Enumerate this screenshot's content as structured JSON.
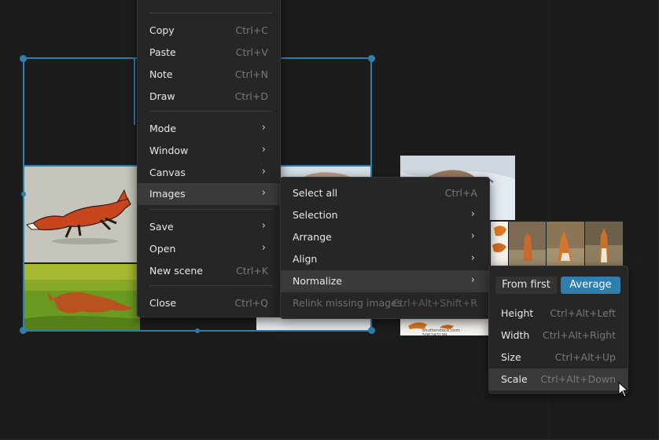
{
  "colors": {
    "accent": "#2e7fb0",
    "menu_bg": "#262626",
    "canvas_bg": "#1c1c1c"
  },
  "main_menu": {
    "items": [
      {
        "label": "Copy",
        "shortcut": "Ctrl+C"
      },
      {
        "label": "Paste",
        "shortcut": "Ctrl+V"
      },
      {
        "label": "Note",
        "shortcut": "Ctrl+N"
      },
      {
        "label": "Draw",
        "shortcut": "Ctrl+D"
      },
      {
        "label": "Mode"
      },
      {
        "label": "Window"
      },
      {
        "label": "Canvas"
      },
      {
        "label": "Images"
      },
      {
        "label": "Save"
      },
      {
        "label": "Open"
      },
      {
        "label": "New scene",
        "shortcut": "Ctrl+K"
      },
      {
        "label": "Close",
        "shortcut": "Ctrl+Q"
      }
    ]
  },
  "images_menu": {
    "items": [
      {
        "label": "Select all",
        "shortcut": "Ctrl+A"
      },
      {
        "label": "Selection"
      },
      {
        "label": "Arrange"
      },
      {
        "label": "Align"
      },
      {
        "label": "Normalize"
      },
      {
        "label": "Relink missing images",
        "shortcut": "Ctrl+Alt+Shift+R"
      }
    ]
  },
  "normalize_menu": {
    "toggle": {
      "from_first": "From first",
      "average": "Average"
    },
    "items": [
      {
        "label": "Height",
        "shortcut": "Ctrl+Alt+Left"
      },
      {
        "label": "Width",
        "shortcut": "Ctrl+Alt+Right"
      },
      {
        "label": "Size",
        "shortcut": "Ctrl+Alt+Up"
      },
      {
        "label": "Scale",
        "shortcut": "Ctrl+Alt+Down"
      }
    ]
  },
  "canvas": {
    "watermark": "shutterstock.com · 506243199"
  }
}
